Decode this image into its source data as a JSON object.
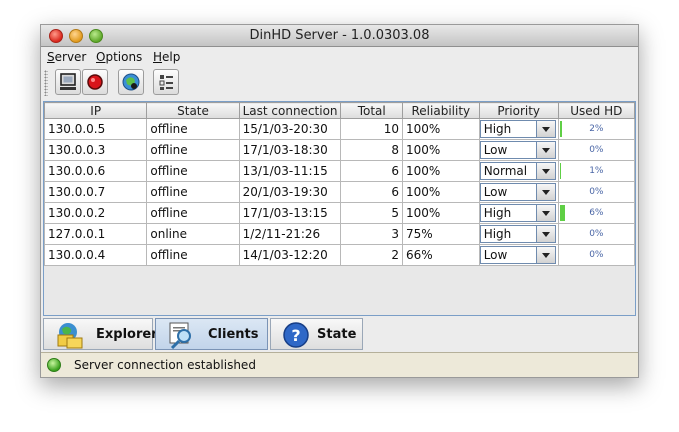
{
  "window": {
    "title": "DinHD Server - 1.0.0303.08"
  },
  "menu": [
    {
      "first": "S",
      "rest": "erver"
    },
    {
      "first": "O",
      "rest": "ptions"
    },
    {
      "first": "H",
      "rest": "elp"
    }
  ],
  "toolbar": {
    "buttons": [
      "monitor-icon",
      "record-stop-icon",
      "refresh-globe-icon",
      "list-settings-icon"
    ]
  },
  "table": {
    "columns": [
      "IP",
      "State",
      "Last connection",
      "Total",
      "Reliability",
      "Priority",
      "Used HD"
    ],
    "rows": [
      {
        "ip": "130.0.0.5",
        "state": "offline",
        "last": "15/1/03-20:30",
        "total": "10",
        "reliability": "100%",
        "priority": "High",
        "used_hd": "2%",
        "used_hd_value": 0.02
      },
      {
        "ip": "130.0.0.3",
        "state": "offline",
        "last": "17/1/03-18:30",
        "total": "8",
        "reliability": "100%",
        "priority": "Low",
        "used_hd": "0%",
        "used_hd_value": 0
      },
      {
        "ip": "130.0.0.6",
        "state": "offline",
        "last": "13/1/03-11:15",
        "total": "6",
        "reliability": "100%",
        "priority": "Normal",
        "used_hd": "1%",
        "used_hd_value": 0.01
      },
      {
        "ip": "130.0.0.7",
        "state": "offline",
        "last": "20/1/03-19:30",
        "total": "6",
        "reliability": "100%",
        "priority": "Low",
        "used_hd": "0%",
        "used_hd_value": 0
      },
      {
        "ip": "130.0.0.2",
        "state": "offline",
        "last": "17/1/03-13:15",
        "total": "5",
        "reliability": "100%",
        "priority": "High",
        "used_hd": "6%",
        "used_hd_value": 0.06
      },
      {
        "ip": "127.0.0.1",
        "state": "online",
        "last": "1/2/11-21:26",
        "total": "3",
        "reliability": "75%",
        "priority": "High",
        "used_hd": "0%",
        "used_hd_value": 0
      },
      {
        "ip": "130.0.0.4",
        "state": "offline",
        "last": "14/1/03-12:20",
        "total": "2",
        "reliability": "66%",
        "priority": "Low",
        "used_hd": "0%",
        "used_hd_value": 0
      }
    ]
  },
  "tabs": [
    {
      "label": "Explorer",
      "icon": "explorer-folders-icon",
      "active": false
    },
    {
      "label": "Clients",
      "icon": "clients-search-icon",
      "active": true
    },
    {
      "label": "State",
      "icon": "help-question-icon",
      "active": false
    }
  ],
  "status": {
    "text": "Server connection established",
    "color": "#3aa11d"
  },
  "colors": {
    "hd_fill": "#5fcf45",
    "hd_text": "#4a66a6",
    "active_tab": "#c2d4ea"
  }
}
